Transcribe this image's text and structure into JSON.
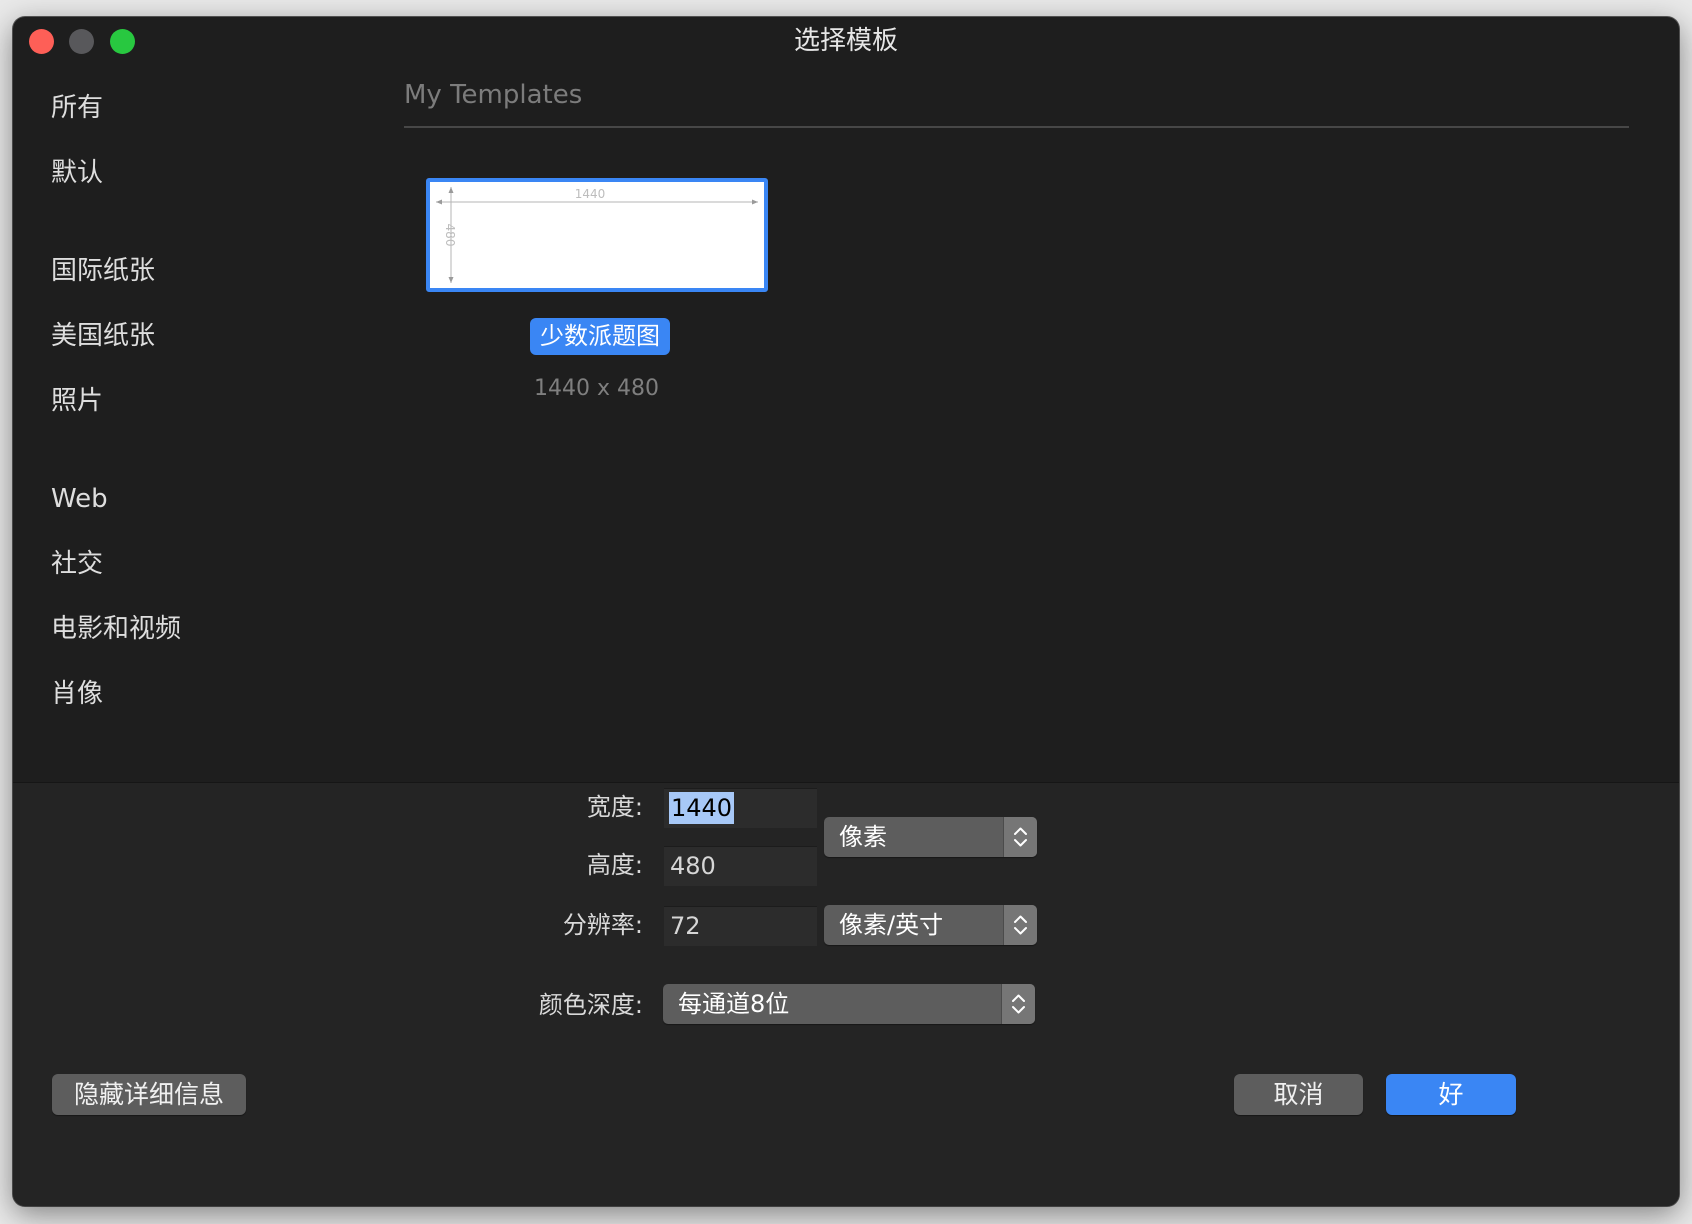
{
  "window": {
    "title": "选择模板"
  },
  "sidebar": {
    "items": [
      {
        "label": "所有"
      },
      {
        "label": "默认"
      },
      {
        "label": "国际纸张"
      },
      {
        "label": "美国纸张"
      },
      {
        "label": "照片"
      },
      {
        "label": "Web"
      },
      {
        "label": "社交"
      },
      {
        "label": "电影和视频"
      },
      {
        "label": "肖像"
      }
    ]
  },
  "main": {
    "section_title": "My Templates",
    "templates": [
      {
        "name": "少数派题图",
        "size": "1440 x 480",
        "preview_width_label": "1440",
        "preview_height_label": "480"
      }
    ]
  },
  "details": {
    "width_label": "宽度:",
    "width_value": "1440",
    "height_label": "高度:",
    "height_value": "480",
    "resolution_label": "分辨率:",
    "resolution_value": "72",
    "size_unit": "像素",
    "resolution_unit": "像素/英寸",
    "color_depth_label": "颜色深度:",
    "color_depth_value": "每通道8位"
  },
  "buttons": {
    "hide_details": "隐藏详细信息",
    "cancel": "取消",
    "ok": "好"
  },
  "colors": {
    "accent": "#3a86f4",
    "window_bg": "#1e1e1e",
    "close": "#fe5f57",
    "minimize": "#58585b",
    "maximize": "#28c840"
  }
}
